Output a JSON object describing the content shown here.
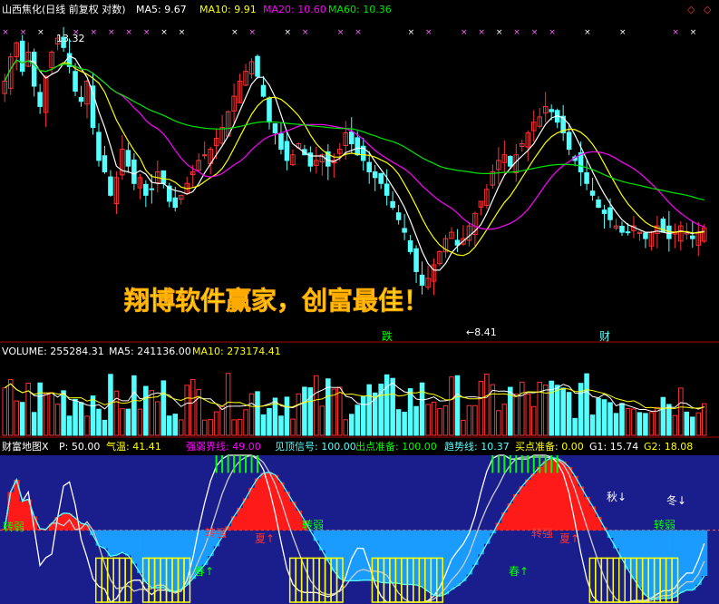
{
  "header": {
    "title": "山西焦化(日线 前复权 对数)",
    "ma5": "MA5: 9.67",
    "ma10": "MA10: 9.91",
    "ma20": "MA20: 10.60",
    "ma60": "MA60: 10.36"
  },
  "annotations": {
    "high_label": "13.32",
    "low_label": "8.41",
    "watermark": "翔博软件赢家，创富最佳！",
    "tag_drop": "跌",
    "tag_wealth": "财"
  },
  "volume_header": {
    "volume": "VOLUME: 255284.31",
    "ma5": "MA5: 241136.00",
    "ma10": "MA10: 273174.41"
  },
  "indicator_header": {
    "name": "财富地图X",
    "p": "P: 50.00",
    "temp": "气温: 41.41",
    "strength": "强弱界线: 49.00",
    "top_signal": "见顶信号: 100.00",
    "exit_ready": "出点准备: 100.00",
    "trend": "趋势线: 10.37",
    "buy_ready": "买点准备: 0.00",
    "g1": "G1: 15.74",
    "g2": "G2: 18.08"
  },
  "indicator_labels": {
    "weak": "转弱",
    "strong": "转强",
    "summer": "夏↑",
    "spring": "春↑",
    "autumn": "秋↓",
    "winter": "冬↓"
  },
  "colors": {
    "up": "#ff3232",
    "down": "#54ffff",
    "ma5": "#ffffff",
    "ma10": "#ffff00",
    "ma20": "#ff00ff",
    "ma60": "#00e600",
    "panel_bg": "#1a1e8c"
  },
  "chart_data": {
    "type": "candlestick",
    "bars": 120,
    "price_range": [
      8.41,
      13.32
    ],
    "last_close": 9.67,
    "close": [
      12.3,
      12.8,
      13.1,
      12.5,
      12.9,
      12.2,
      11.8,
      12.4,
      12.9,
      13.2,
      13.0,
      12.6,
      12.1,
      11.9,
      12.3,
      11.4,
      10.8,
      10.6,
      10.2,
      10.5,
      11.0,
      10.7,
      10.4,
      10.5,
      10.2,
      10.3,
      10.6,
      10.4,
      10.1,
      10.0,
      10.2,
      10.4,
      10.6,
      10.8,
      10.9,
      11.0,
      11.2,
      11.4,
      11.7,
      12.0,
      12.3,
      12.5,
      12.7,
      12.4,
      12.0,
      11.5,
      11.3,
      11.0,
      10.8,
      10.9,
      11.1,
      10.9,
      10.7,
      10.8,
      10.9,
      10.7,
      10.8,
      11.0,
      11.3,
      11.1,
      10.9,
      10.8,
      10.6,
      10.5,
      10.4,
      10.2,
      10.0,
      9.8,
      9.6,
      9.3,
      9.0,
      8.8,
      8.9,
      9.1,
      9.3,
      9.5,
      9.6,
      9.4,
      9.5,
      9.7,
      9.9,
      10.1,
      10.3,
      10.6,
      10.8,
      10.9,
      10.7,
      10.9,
      11.1,
      11.3,
      11.5,
      11.6,
      11.8,
      11.7,
      11.5,
      11.3,
      11.0,
      10.8,
      10.6,
      10.4,
      10.2,
      10.0,
      9.9,
      9.8,
      9.7,
      9.6,
      9.6,
      9.7,
      9.6,
      9.5,
      9.6,
      9.7,
      9.6,
      9.5,
      9.6,
      9.7,
      9.6,
      9.5,
      9.6,
      9.67
    ],
    "volume_range": [
      0,
      600000
    ],
    "last_volume": 255284.31
  }
}
